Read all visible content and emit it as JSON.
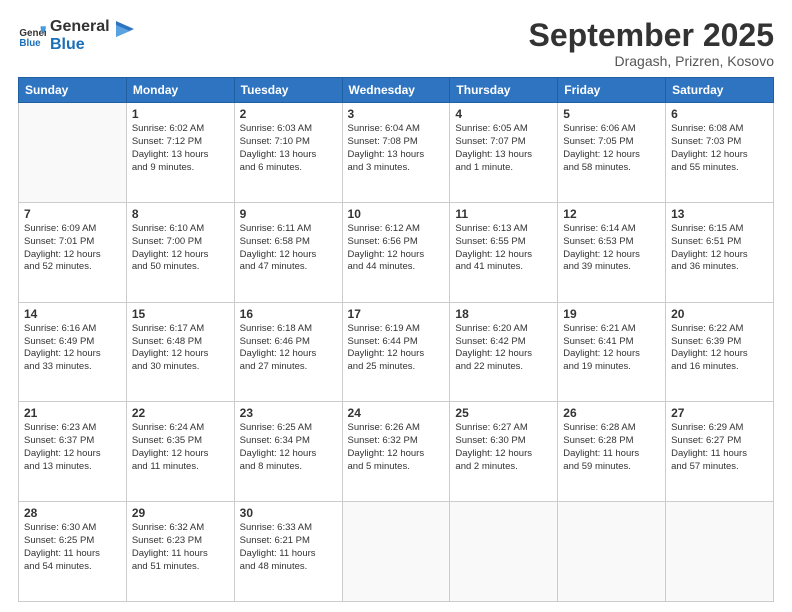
{
  "header": {
    "logo_line1": "General",
    "logo_line2": "Blue",
    "month": "September 2025",
    "location": "Dragash, Prizren, Kosovo"
  },
  "days_of_week": [
    "Sunday",
    "Monday",
    "Tuesday",
    "Wednesday",
    "Thursday",
    "Friday",
    "Saturday"
  ],
  "weeks": [
    [
      {
        "day": "",
        "info": ""
      },
      {
        "day": "1",
        "info": "Sunrise: 6:02 AM\nSunset: 7:12 PM\nDaylight: 13 hours\nand 9 minutes."
      },
      {
        "day": "2",
        "info": "Sunrise: 6:03 AM\nSunset: 7:10 PM\nDaylight: 13 hours\nand 6 minutes."
      },
      {
        "day": "3",
        "info": "Sunrise: 6:04 AM\nSunset: 7:08 PM\nDaylight: 13 hours\nand 3 minutes."
      },
      {
        "day": "4",
        "info": "Sunrise: 6:05 AM\nSunset: 7:07 PM\nDaylight: 13 hours\nand 1 minute."
      },
      {
        "day": "5",
        "info": "Sunrise: 6:06 AM\nSunset: 7:05 PM\nDaylight: 12 hours\nand 58 minutes."
      },
      {
        "day": "6",
        "info": "Sunrise: 6:08 AM\nSunset: 7:03 PM\nDaylight: 12 hours\nand 55 minutes."
      }
    ],
    [
      {
        "day": "7",
        "info": "Sunrise: 6:09 AM\nSunset: 7:01 PM\nDaylight: 12 hours\nand 52 minutes."
      },
      {
        "day": "8",
        "info": "Sunrise: 6:10 AM\nSunset: 7:00 PM\nDaylight: 12 hours\nand 50 minutes."
      },
      {
        "day": "9",
        "info": "Sunrise: 6:11 AM\nSunset: 6:58 PM\nDaylight: 12 hours\nand 47 minutes."
      },
      {
        "day": "10",
        "info": "Sunrise: 6:12 AM\nSunset: 6:56 PM\nDaylight: 12 hours\nand 44 minutes."
      },
      {
        "day": "11",
        "info": "Sunrise: 6:13 AM\nSunset: 6:55 PM\nDaylight: 12 hours\nand 41 minutes."
      },
      {
        "day": "12",
        "info": "Sunrise: 6:14 AM\nSunset: 6:53 PM\nDaylight: 12 hours\nand 39 minutes."
      },
      {
        "day": "13",
        "info": "Sunrise: 6:15 AM\nSunset: 6:51 PM\nDaylight: 12 hours\nand 36 minutes."
      }
    ],
    [
      {
        "day": "14",
        "info": "Sunrise: 6:16 AM\nSunset: 6:49 PM\nDaylight: 12 hours\nand 33 minutes."
      },
      {
        "day": "15",
        "info": "Sunrise: 6:17 AM\nSunset: 6:48 PM\nDaylight: 12 hours\nand 30 minutes."
      },
      {
        "day": "16",
        "info": "Sunrise: 6:18 AM\nSunset: 6:46 PM\nDaylight: 12 hours\nand 27 minutes."
      },
      {
        "day": "17",
        "info": "Sunrise: 6:19 AM\nSunset: 6:44 PM\nDaylight: 12 hours\nand 25 minutes."
      },
      {
        "day": "18",
        "info": "Sunrise: 6:20 AM\nSunset: 6:42 PM\nDaylight: 12 hours\nand 22 minutes."
      },
      {
        "day": "19",
        "info": "Sunrise: 6:21 AM\nSunset: 6:41 PM\nDaylight: 12 hours\nand 19 minutes."
      },
      {
        "day": "20",
        "info": "Sunrise: 6:22 AM\nSunset: 6:39 PM\nDaylight: 12 hours\nand 16 minutes."
      }
    ],
    [
      {
        "day": "21",
        "info": "Sunrise: 6:23 AM\nSunset: 6:37 PM\nDaylight: 12 hours\nand 13 minutes."
      },
      {
        "day": "22",
        "info": "Sunrise: 6:24 AM\nSunset: 6:35 PM\nDaylight: 12 hours\nand 11 minutes."
      },
      {
        "day": "23",
        "info": "Sunrise: 6:25 AM\nSunset: 6:34 PM\nDaylight: 12 hours\nand 8 minutes."
      },
      {
        "day": "24",
        "info": "Sunrise: 6:26 AM\nSunset: 6:32 PM\nDaylight: 12 hours\nand 5 minutes."
      },
      {
        "day": "25",
        "info": "Sunrise: 6:27 AM\nSunset: 6:30 PM\nDaylight: 12 hours\nand 2 minutes."
      },
      {
        "day": "26",
        "info": "Sunrise: 6:28 AM\nSunset: 6:28 PM\nDaylight: 11 hours\nand 59 minutes."
      },
      {
        "day": "27",
        "info": "Sunrise: 6:29 AM\nSunset: 6:27 PM\nDaylight: 11 hours\nand 57 minutes."
      }
    ],
    [
      {
        "day": "28",
        "info": "Sunrise: 6:30 AM\nSunset: 6:25 PM\nDaylight: 11 hours\nand 54 minutes."
      },
      {
        "day": "29",
        "info": "Sunrise: 6:32 AM\nSunset: 6:23 PM\nDaylight: 11 hours\nand 51 minutes."
      },
      {
        "day": "30",
        "info": "Sunrise: 6:33 AM\nSunset: 6:21 PM\nDaylight: 11 hours\nand 48 minutes."
      },
      {
        "day": "",
        "info": ""
      },
      {
        "day": "",
        "info": ""
      },
      {
        "day": "",
        "info": ""
      },
      {
        "day": "",
        "info": ""
      }
    ]
  ]
}
